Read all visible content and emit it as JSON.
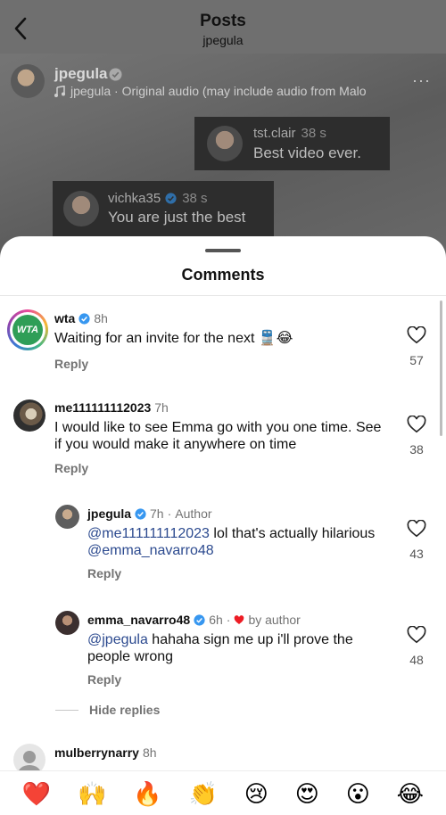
{
  "header": {
    "title": "Posts",
    "subtitle": "jpegula"
  },
  "post": {
    "owner": "jpegula",
    "audio": "jpegula · Original audio (may include audio from Malo",
    "live_comments": [
      {
        "user": "tst.clair",
        "time": "38 s",
        "text": "Best video ever."
      },
      {
        "user": "vichka35",
        "time": "38 s",
        "text": "You are just the best"
      }
    ]
  },
  "sheet": {
    "title": "Comments"
  },
  "comments": [
    {
      "user": "wta",
      "time": "8h",
      "text": "Waiting for an invite for the next 🚆😂",
      "reply": "Reply",
      "likes": "57"
    },
    {
      "user": "me111111112023",
      "time": "7h",
      "text": "I would like to see Emma go with you one time. See if you would make it anywhere on time",
      "reply": "Reply",
      "likes": "38"
    },
    {
      "user": "jpegula",
      "time": "7h",
      "author_tag": "Author",
      "mention": "@me111111112023",
      "text_mid": " lol that's actually hilarious ",
      "mention2": "@emma_navarro48",
      "reply": "Reply",
      "likes": "43"
    },
    {
      "user": "emma_navarro48",
      "time": "6h",
      "author_tag": "by author",
      "mention": "@jpegula",
      "text_mid": " hahaha sign me up i'll prove the people wrong",
      "reply": "Reply",
      "likes": "48"
    },
    {
      "user": "mulberrynarry",
      "time": "8h"
    }
  ],
  "hide_replies": "Hide replies",
  "avatar_logo": "WTA",
  "emojis": [
    "❤️",
    "🙌",
    "🔥",
    "👏",
    "😢",
    "😍",
    "😮",
    "😂"
  ],
  "colors": {
    "mention": "#2c4a8f",
    "verified": "#3797f0",
    "heart_red": "#ed1c24"
  }
}
